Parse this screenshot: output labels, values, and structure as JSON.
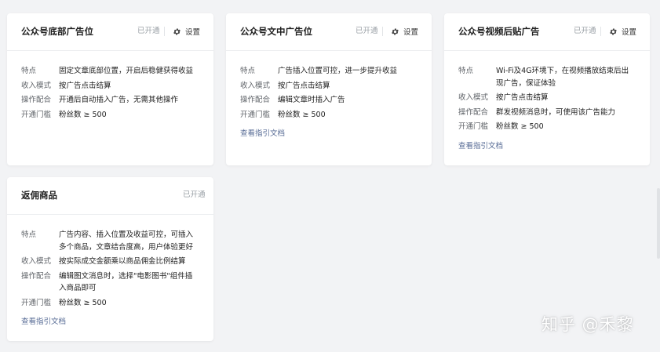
{
  "common": {
    "status": "已开通",
    "settings_label": "设置",
    "guide_link": "查看指引文档"
  },
  "cards": [
    {
      "title": "公众号底部广告位",
      "rows": [
        {
          "label": "特点",
          "value": "固定文章底部位置，开启后稳健获得收益"
        },
        {
          "label": "收入模式",
          "value": "按广告点击结算"
        },
        {
          "label": "操作配合",
          "value": "开通后自动插入广告，无需其他操作"
        },
        {
          "label": "开通门槛",
          "value": "粉丝数 ≥ 500"
        }
      ]
    },
    {
      "title": "公众号文中广告位",
      "rows": [
        {
          "label": "特点",
          "value": "广告插入位置可控，进一步提升收益"
        },
        {
          "label": "收入模式",
          "value": "按广告点击结算"
        },
        {
          "label": "操作配合",
          "value": "编辑文章时插入广告"
        },
        {
          "label": "开通门槛",
          "value": "粉丝数 ≥ 500"
        }
      ]
    },
    {
      "title": "公众号视频后贴广告",
      "rows": [
        {
          "label": "特点",
          "value": "Wi-Fi及4G环境下，在视频播放结束后出现广告，保证体验"
        },
        {
          "label": "收入模式",
          "value": "按广告点击结算"
        },
        {
          "label": "操作配合",
          "value": "群发视频消息时，可使用该广告能力"
        },
        {
          "label": "开通门槛",
          "value": "粉丝数 ≥ 500"
        }
      ]
    },
    {
      "title": "返佣商品",
      "rows": [
        {
          "label": "特点",
          "value": "广告内容、插入位置及收益可控，可插入多个商品，文章结合度高，用户体验更好"
        },
        {
          "label": "收入模式",
          "value": "按实际成交金额乘以商品佣金比例结算"
        },
        {
          "label": "操作配合",
          "value": "编辑图文消息时，选择\"电影图书\"组件插入商品即可"
        },
        {
          "label": "开通门槛",
          "value": "粉丝数 ≥ 500"
        }
      ]
    }
  ],
  "watermark": "知乎 @禾黎",
  "colors": {
    "background": "#f2f3f5",
    "card": "#ffffff",
    "link": "#576b95",
    "muted": "#9aa0a6"
  }
}
